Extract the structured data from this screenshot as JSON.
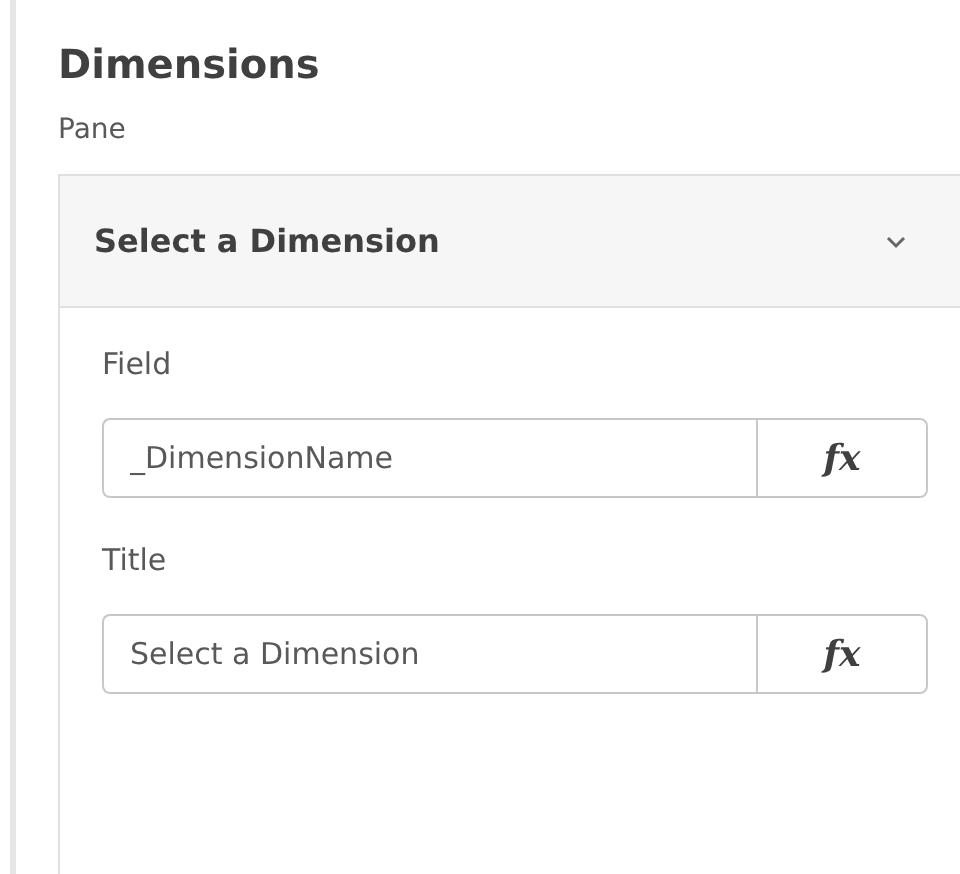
{
  "heading": "Dimensions",
  "subheading": "Pane",
  "section": {
    "title": "Select a Dimension",
    "expanded": true,
    "fields": [
      {
        "label": "Field",
        "value": "_DimensionName",
        "button": "fx"
      },
      {
        "label": "Title",
        "value": "Select a Dimension",
        "button": "fx"
      }
    ]
  }
}
